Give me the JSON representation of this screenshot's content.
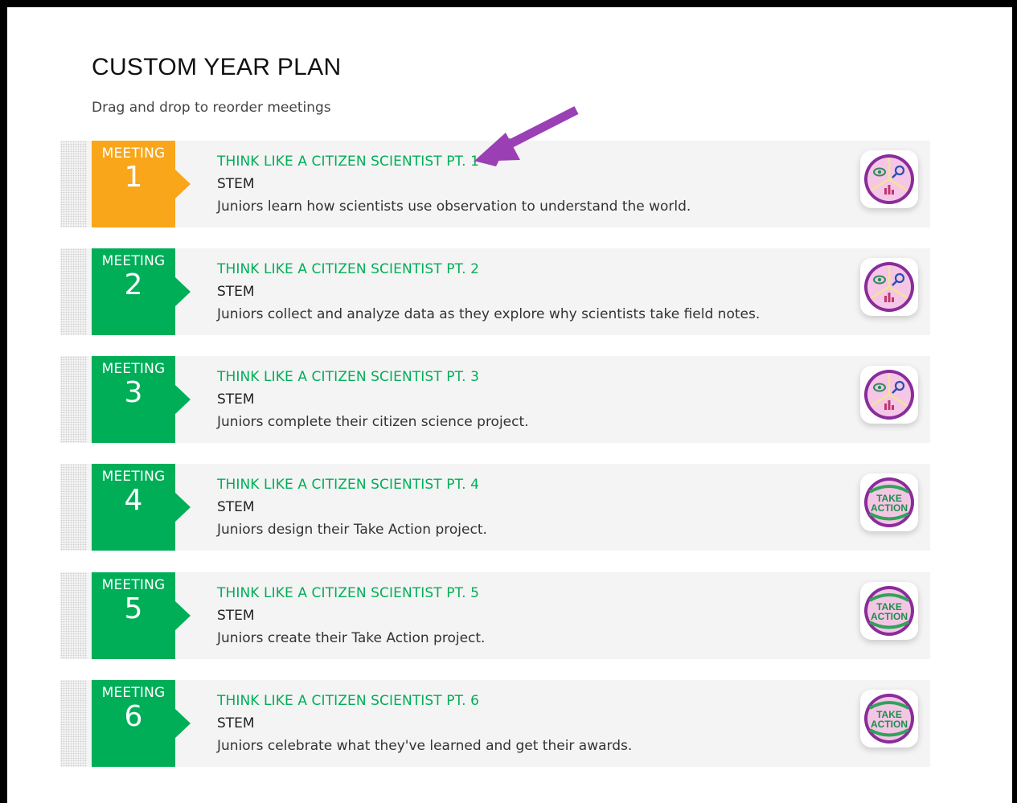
{
  "header": {
    "title": "CUSTOM YEAR PLAN",
    "subtitle": "Drag and drop to reorder meetings"
  },
  "meetings": [
    {
      "label": "MEETING",
      "number": "1",
      "title": "THINK LIKE A CITIZEN SCIENTIST PT. 1",
      "category": "STEM",
      "description": "Juniors learn how scientists use observation to understand the world.",
      "color": "#faa61a",
      "icon": "citizen-scientist-badge-icon"
    },
    {
      "label": "MEETING",
      "number": "2",
      "title": "THINK LIKE A CITIZEN SCIENTIST PT. 2",
      "category": "STEM",
      "description": "Juniors collect and analyze data as they explore why scientists take field notes.",
      "color": "#00ae58",
      "icon": "citizen-scientist-badge-icon"
    },
    {
      "label": "MEETING",
      "number": "3",
      "title": "THINK LIKE A CITIZEN SCIENTIST PT. 3",
      "category": "STEM",
      "description": "Juniors complete their citizen science project.",
      "color": "#00ae58",
      "icon": "citizen-scientist-badge-icon"
    },
    {
      "label": "MEETING",
      "number": "4",
      "title": "THINK LIKE A CITIZEN SCIENTIST PT. 4",
      "category": "STEM",
      "description": "Juniors design their Take Action project.",
      "color": "#00ae58",
      "icon": "take-action-badge-icon",
      "badge_text": [
        "TAKE",
        "ACTION"
      ]
    },
    {
      "label": "MEETING",
      "number": "5",
      "title": "THINK LIKE A CITIZEN SCIENTIST PT. 5",
      "category": "STEM",
      "description": "Juniors create their Take Action project.",
      "color": "#00ae58",
      "icon": "take-action-badge-icon",
      "badge_text": [
        "TAKE",
        "ACTION"
      ]
    },
    {
      "label": "MEETING",
      "number": "6",
      "title": "THINK LIKE A CITIZEN SCIENTIST PT. 6",
      "category": "STEM",
      "description": "Juniors celebrate what they've learned and get their awards.",
      "color": "#00ae58",
      "icon": "take-action-badge-icon",
      "badge_text": [
        "TAKE",
        "ACTION"
      ]
    }
  ],
  "colors": {
    "accent_green": "#00ae58",
    "highlight_orange": "#faa61a",
    "annotation_arrow": "#9b3fb5"
  }
}
